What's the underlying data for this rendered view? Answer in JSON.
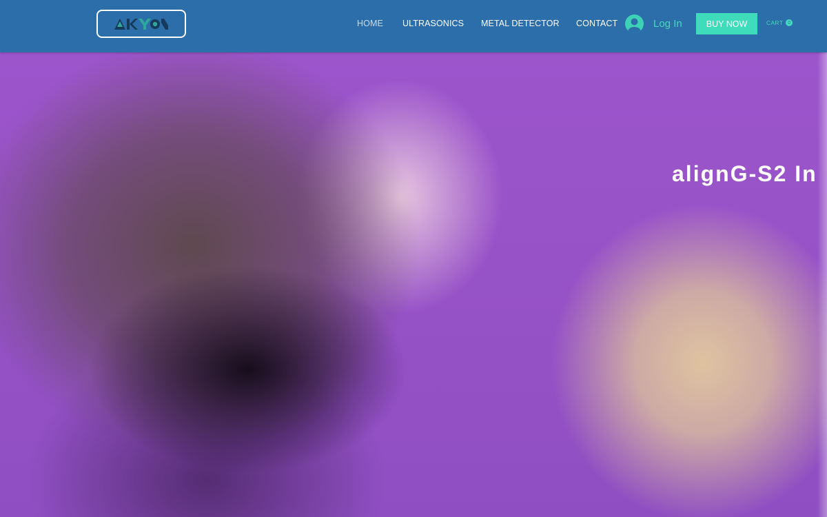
{
  "header": {
    "logo_text": "AKYON",
    "nav": [
      {
        "label": "HOME",
        "active": true
      },
      {
        "label": "ULTRASONICS",
        "active": false
      },
      {
        "label": "METAL DETECTOR",
        "active": false
      },
      {
        "label": "CONTACT",
        "active": false
      }
    ],
    "login_label": "Log In",
    "buy_label": "BUY NOW",
    "cart_label": "CART",
    "cart_count": "0"
  },
  "hero": {
    "title": "alignG-S2 In"
  },
  "colors": {
    "header_bg": "#2b6ea9",
    "accent": "#3fdcbc",
    "hero_bg": "#9150c6"
  },
  "icons": [
    "user-avatar-icon",
    "cart-count-badge"
  ]
}
